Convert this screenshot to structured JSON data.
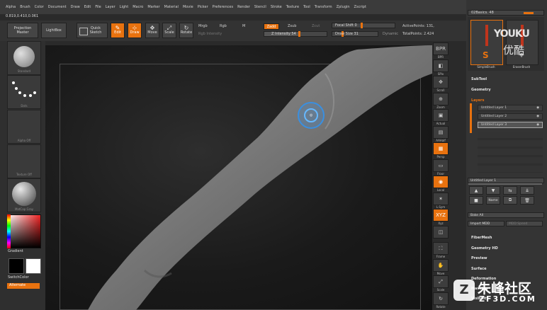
{
  "menu": [
    "Alpha",
    "Brush",
    "Color",
    "Document",
    "Draw",
    "Edit",
    "File",
    "Layer",
    "Light",
    "Macro",
    "Marker",
    "Material",
    "Movie",
    "Picker",
    "Preferences",
    "Render",
    "Stencil",
    "Stroke",
    "Texture",
    "Tool",
    "Transform",
    "Zplugin",
    "Zscript"
  ],
  "coords": "0.819,0.410,0.061",
  "toolbar": {
    "projection_master": "Projection Master",
    "lightbox": "LightBox",
    "quick_sketch": "Quick Sketch",
    "edit": "Edit",
    "draw": "Draw",
    "move": "Move",
    "scale": "Scale",
    "rotate": "Rotate",
    "mrgb": "Mrgb",
    "rgb": "Rgb",
    "m": "M",
    "rgb_intensity": "Rgb Intensity",
    "zadd": "Zadd",
    "zsub": "Zsub",
    "zcut": "Zcut",
    "z_intensity": "Z Intensity 54",
    "focal_shift": "Focal Shift 0",
    "draw_size": "Draw Size 31",
    "dynamic": "Dynamic",
    "active_points": "ActivePoints: 131,",
    "total_points": "TotalPoints: 2.424"
  },
  "left": {
    "brush_label": "Standard",
    "stroke_label": "Dots",
    "alpha_label": "Alpha Off",
    "texture_label": "Texture Off",
    "material_label": "MatCap Gray",
    "gradient": "Gradient",
    "switch_color": "SwitchColor",
    "alternate": "Alternate"
  },
  "right_strip": [
    {
      "icon": "BPR",
      "label": "BPR"
    },
    {
      "icon": "◧",
      "label": "SPix"
    },
    {
      "icon": "✥",
      "label": "Scroll"
    },
    {
      "icon": "⊕",
      "label": "Zoom"
    },
    {
      "icon": "▣",
      "label": "Actual"
    },
    {
      "icon": "▤",
      "label": "AAHalf"
    },
    {
      "icon": "▦",
      "label": "Persp"
    },
    {
      "icon": "▭",
      "label": "Floor"
    },
    {
      "icon": "◉",
      "label": "Local"
    },
    {
      "icon": "✶",
      "label": "L.Sym"
    },
    {
      "icon": "XYZ",
      "label": "Xyz"
    },
    {
      "icon": "◫",
      "label": ""
    },
    {
      "icon": "⛶",
      "label": "Frame"
    },
    {
      "icon": "✋",
      "label": "Move"
    },
    {
      "icon": "⤢",
      "label": "Scale"
    },
    {
      "icon": "↻",
      "label": "Rotate"
    }
  ],
  "side": {
    "brush_label": "02Basics. 48",
    "simple_brush": "SimpleBrush",
    "erase_brush": "EraserBrush",
    "subtool": "SubTool",
    "geometry": "Geometry",
    "layers": "Layers",
    "layer_items": [
      "Untitled Layer 1",
      "Untitled Layer 2",
      "Untitled Layer 3"
    ],
    "current_layer": "Untitled Layer 1",
    "name": "Name",
    "bake_all": "Bake All",
    "import_mdd": "Import MDD",
    "mdd_speed": "MDD Speed",
    "fibermesh": "FiberMesh",
    "geometry_hd": "Geometry HD",
    "preview": "Preview",
    "surface": "Surface",
    "deformation": "Deformation",
    "masking": "Masking",
    "visibility": "Visibility"
  },
  "watermarks": {
    "youku_latin": "YOUKU",
    "youku_cjk": "优酷",
    "site_name": "朱峰社区",
    "site_url": "ZF3D.COM"
  },
  "colors": {
    "accent": "#e8720f"
  }
}
